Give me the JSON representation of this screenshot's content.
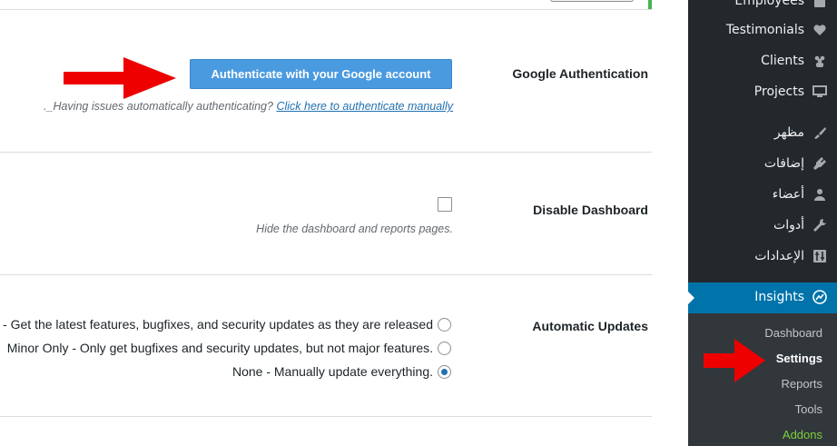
{
  "settings": {
    "google_auth": {
      "label": "Google Authentication",
      "button_label": "Authenticate with your Google account",
      "help_text": "Having issues automatically authenticating? ",
      "help_link": "Click here to authenticate manually",
      "help_suffix": "._"
    },
    "dashboard": {
      "label": "Disable Dashboard",
      "checked": false,
      "help_text": "Hide the dashboard and reports pages."
    },
    "updates": {
      "label": "Automatic Updates",
      "options": [
        {
          "label": "All - Get the latest features, bugfixes, and security updates as they are released",
          "checked": false
        },
        {
          "label": "Minor Only - Only get bugfixes and security updates, but not major features.",
          "checked": false
        },
        {
          "label": "None - Manually update everything.",
          "checked": true
        }
      ]
    }
  },
  "sidebar": {
    "items": [
      {
        "label": "Employees",
        "icon": "employees-icon"
      },
      {
        "label": "Testimonials",
        "icon": "heart-icon"
      },
      {
        "label": "Clients",
        "icon": "clients-icon"
      },
      {
        "label": "Projects",
        "icon": "monitor-icon"
      },
      {
        "label": "مظهر",
        "icon": "brush-icon"
      },
      {
        "label": "إضافات",
        "icon": "plugin-icon"
      },
      {
        "label": "أعضاء",
        "icon": "user-icon"
      },
      {
        "label": "أدوات",
        "icon": "wrench-icon"
      },
      {
        "label": "الإعدادات",
        "icon": "settings-icon"
      }
    ],
    "active": {
      "label": "Insights",
      "icon": "insights-icon"
    },
    "submenu": [
      {
        "label": "Dashboard",
        "current": false
      },
      {
        "label": "Settings",
        "current": true
      },
      {
        "label": "Reports",
        "current": false
      },
      {
        "label": "Tools",
        "current": false
      },
      {
        "label": "Addons",
        "current": false
      }
    ]
  },
  "colors": {
    "accent": "#0073aa",
    "button": "#4a9ae0",
    "sidebar_bg": "#23282d",
    "submenu_bg": "#32373c",
    "addons": "#7ad03a",
    "arrow": "#ee0000"
  }
}
